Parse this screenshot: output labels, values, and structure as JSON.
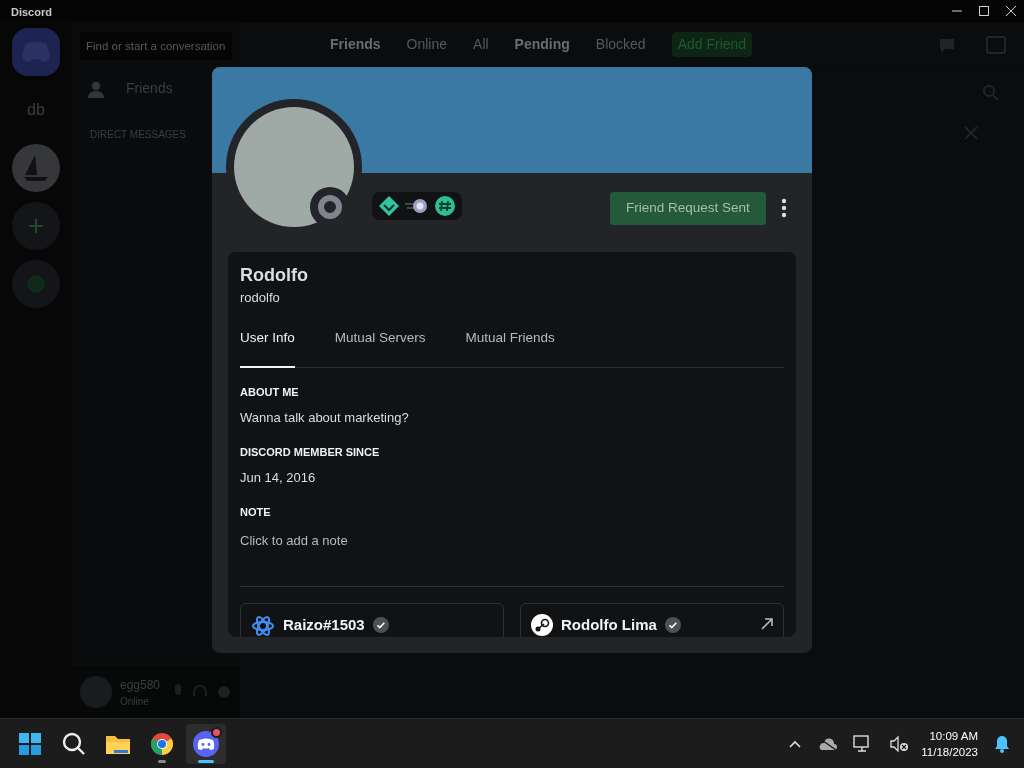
{
  "window": {
    "title": "Discord"
  },
  "server_rail": {
    "items": [
      {
        "kind": "home",
        "selected": true
      },
      {
        "kind": "text",
        "label": "db",
        "selected": false
      },
      {
        "kind": "server",
        "selected": false
      },
      {
        "kind": "add",
        "selected": false
      },
      {
        "kind": "explore",
        "selected": false
      }
    ]
  },
  "dm_sidebar": {
    "search_placeholder": "Find or start a conversation",
    "friends_label": "Friends",
    "section_title": "DIRECT MESSAGES"
  },
  "user_panel": {
    "name": "egg580",
    "status": "Online"
  },
  "header": {
    "title": "Friends",
    "tabs": [
      {
        "label": "Online",
        "selected": false
      },
      {
        "label": "All",
        "selected": false
      },
      {
        "label": "Pending",
        "selected": true
      },
      {
        "label": "Blocked",
        "selected": false
      }
    ],
    "add_friend": "Add Friend"
  },
  "profile": {
    "name": "Rodolfo",
    "username": "rodolfo",
    "action": "Friend Request Sent",
    "tabs": [
      {
        "label": "User Info",
        "selected": true
      },
      {
        "label": "Mutual Servers",
        "selected": false
      },
      {
        "label": "Mutual Friends",
        "selected": false
      }
    ],
    "sections": [
      {
        "kind": "text",
        "heading": "ABOUT ME",
        "text": "Wanna talk about marketing?"
      },
      {
        "kind": "text",
        "heading": "DISCORD MEMBER SINCE",
        "text": "Jun 14, 2016"
      },
      {
        "kind": "note",
        "heading": "NOTE",
        "placeholder": "Click to add a note"
      }
    ],
    "connections": [
      {
        "kind": "battlenet",
        "name": "Raizo#1503",
        "verified": true,
        "external": false
      },
      {
        "kind": "steam",
        "name": "Rodolfo Lima",
        "verified": true,
        "external": true
      }
    ]
  },
  "taskbar": {
    "apps": [
      {
        "kind": "start",
        "active": false
      },
      {
        "kind": "search",
        "active": false
      },
      {
        "kind": "files",
        "active": false
      },
      {
        "kind": "chrome",
        "running": true,
        "active": false
      },
      {
        "kind": "discord",
        "running": true,
        "active": true,
        "notification": true
      }
    ],
    "time": "10:09 AM",
    "date": "11/18/2023"
  }
}
